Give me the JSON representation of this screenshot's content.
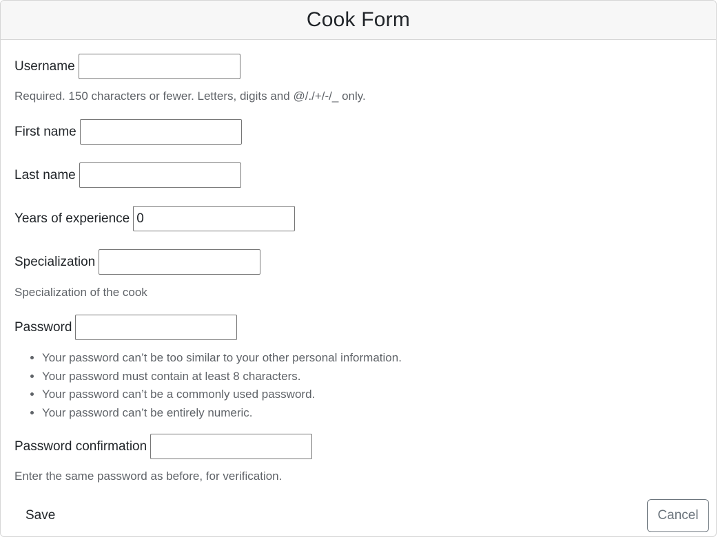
{
  "form": {
    "title": "Cook Form",
    "fields": {
      "username": {
        "label": "Username",
        "value": "",
        "help": "Required. 150 characters or fewer. Letters, digits and @/./+/-/_ only."
      },
      "first_name": {
        "label": "First name",
        "value": ""
      },
      "last_name": {
        "label": "Last name",
        "value": ""
      },
      "years_of_experience": {
        "label": "Years of experience",
        "value": "0"
      },
      "specialization": {
        "label": "Specialization",
        "value": "",
        "help": "Specialization of the cook"
      },
      "password": {
        "label": "Password",
        "value": "",
        "rules": [
          "Your password can’t be too similar to your other personal information.",
          "Your password must contain at least 8 characters.",
          "Your password can’t be a commonly used password.",
          "Your password can’t be entirely numeric."
        ]
      },
      "password_confirmation": {
        "label": "Password confirmation",
        "value": "",
        "help": "Enter the same password as before, for verification."
      }
    },
    "buttons": {
      "save_label": "Save",
      "cancel_label": "Cancel"
    }
  }
}
